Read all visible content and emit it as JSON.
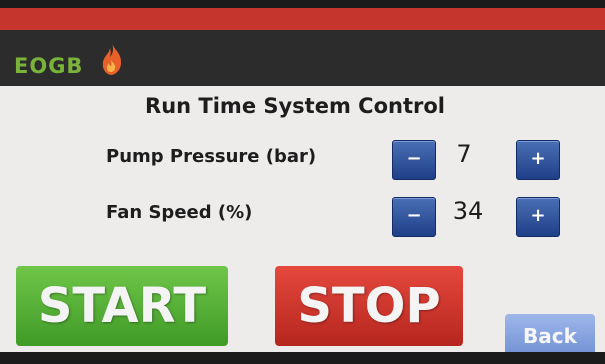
{
  "brand": {
    "logo_text": "EOGB"
  },
  "title": "Run Time System Control",
  "controls": [
    {
      "label": "Pump Pressure (bar)",
      "value": "7",
      "decrement": "−",
      "increment": "+"
    },
    {
      "label": "Fan Speed (%)",
      "value": "34",
      "decrement": "−",
      "increment": "+"
    }
  ],
  "buttons": {
    "start": "START",
    "stop": "STOP",
    "back": "Back"
  },
  "colors": {
    "header_red": "#c5352d",
    "brand_bar": "#2c2c2c",
    "logo_green": "#7ab33a",
    "flame_orange": "#e8602a",
    "stepper_blue": "#2a4f9b",
    "start_green": "#4fae31",
    "stop_red": "#c9322a",
    "back_blue": "#8aa6e0"
  },
  "icons": {
    "logo": "flame-icon"
  }
}
